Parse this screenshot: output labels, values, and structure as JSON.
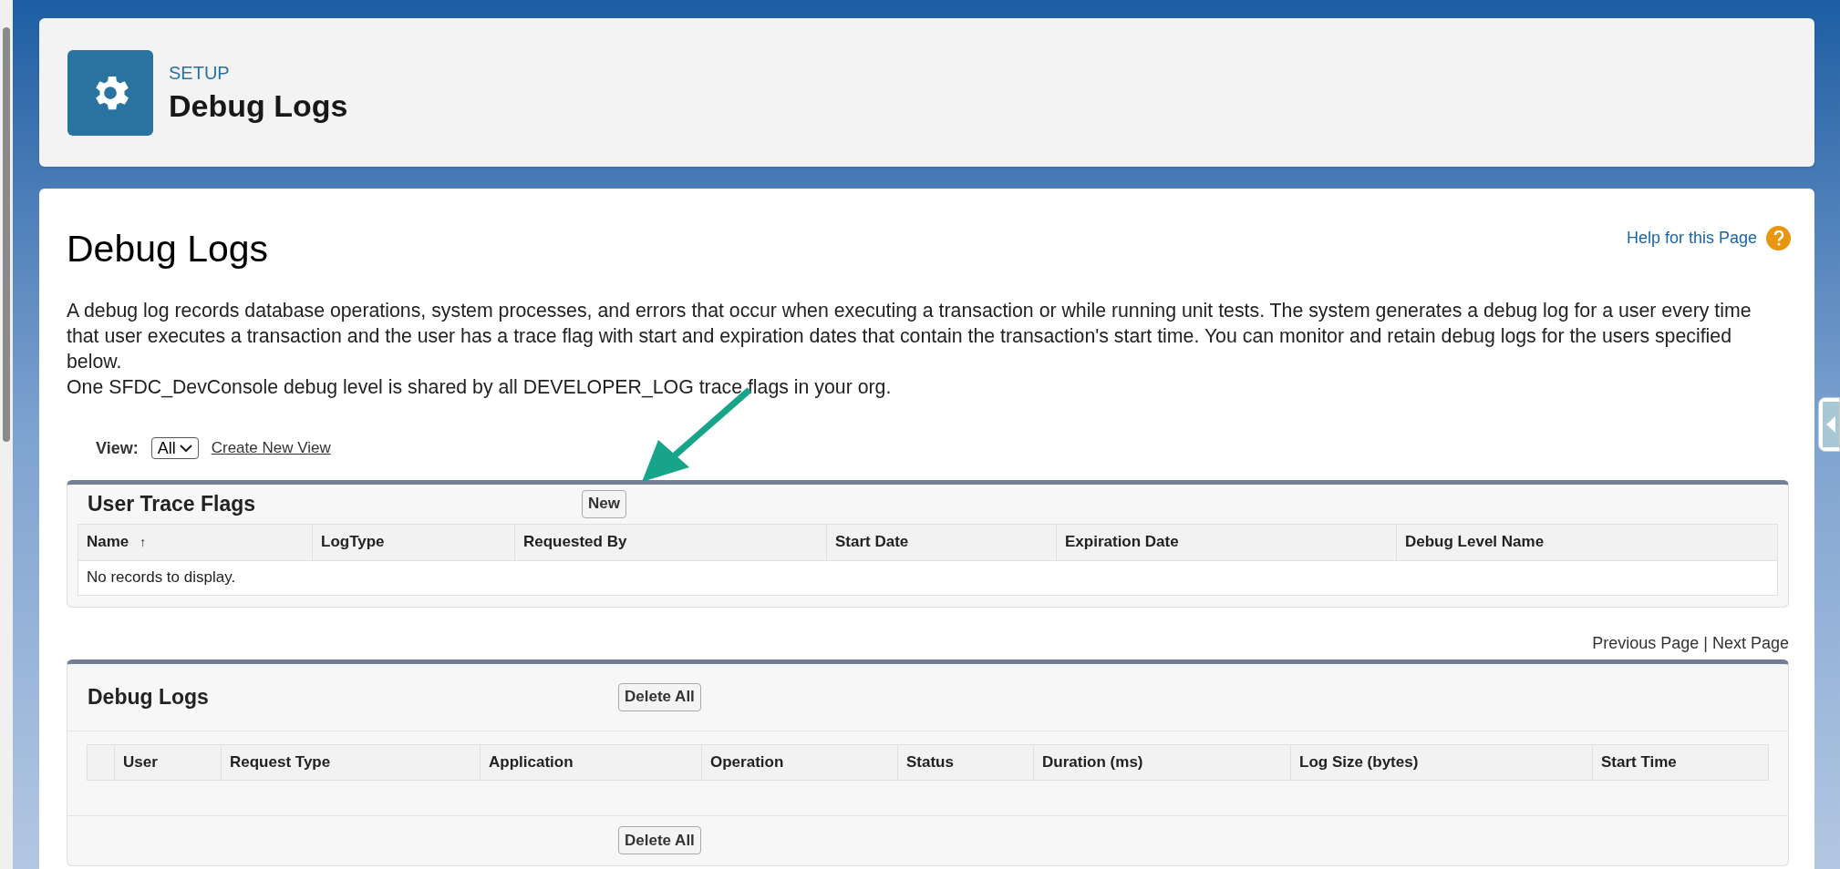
{
  "header": {
    "breadcrumb": "SETUP",
    "title": "Debug Logs"
  },
  "page": {
    "title": "Debug Logs",
    "help_link": "Help for this Page",
    "description": [
      "A debug log records database operations, system processes, and errors that occur when executing a transaction or while running unit tests. The system generates a debug log for a user every time that user executes a transaction and the user has a trace flag with start and expiration dates that contain the transaction's start time. You can monitor and retain debug logs for the users specified below.",
      "One SFDC_DevConsole debug level is shared by all DEVELOPER_LOG trace flags in your org."
    ]
  },
  "view": {
    "label": "View:",
    "value": "All",
    "link": "Create New View"
  },
  "trace_flags": {
    "title": "User Trace Flags",
    "button": "New",
    "columns": [
      {
        "label": "Name",
        "sort_mark": "↑"
      },
      {
        "label": "LogType"
      },
      {
        "label": "Requested By"
      },
      {
        "label": "Start Date"
      },
      {
        "label": "Expiration Date"
      },
      {
        "label": "Debug Level Name"
      }
    ],
    "empty": "No records to display."
  },
  "pagination": {
    "previous": "Previous Page",
    "separator": "|",
    "next": "Next Page"
  },
  "debug_logs": {
    "title": "Debug Logs",
    "top_button": "Delete All",
    "bottom_button": "Delete All",
    "columns": [
      "User",
      "Request Type",
      "Application",
      "Operation",
      "Status",
      "Duration (ms)",
      "Log Size (bytes)",
      "Start Time"
    ]
  }
}
